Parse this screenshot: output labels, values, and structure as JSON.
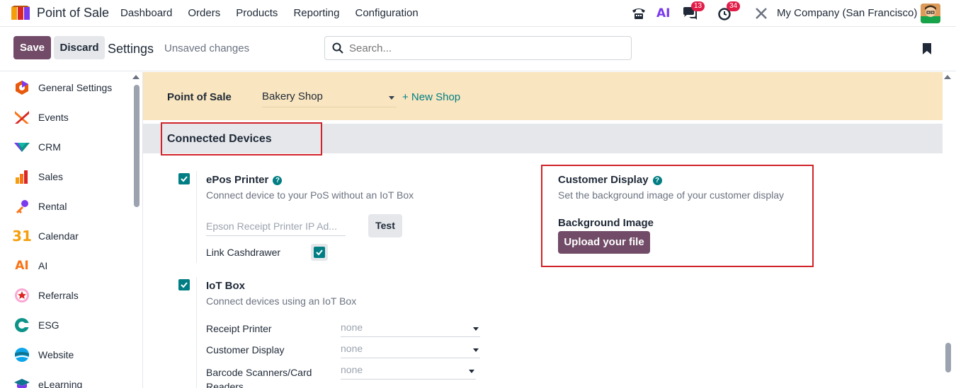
{
  "navbar": {
    "app_name": "Point of Sale",
    "menu": [
      "Dashboard",
      "Orders",
      "Products",
      "Reporting",
      "Configuration"
    ],
    "chat_count": "13",
    "activity_count": "34",
    "ai_label": "AI",
    "company": "My Company (San Francisco)"
  },
  "control_panel": {
    "save_label": "Save",
    "discard_label": "Discard",
    "title": "Settings",
    "status": "Unsaved changes",
    "search_placeholder": "Search..."
  },
  "sidebar": {
    "items": [
      {
        "label": "General Settings",
        "icon": "general-settings-icon",
        "color": "#e8590c"
      },
      {
        "label": "Events",
        "icon": "events-icon",
        "color": "#f97316"
      },
      {
        "label": "CRM",
        "icon": "crm-icon",
        "color": "#0d9488"
      },
      {
        "label": "Sales",
        "icon": "sales-icon",
        "color": "#f97316"
      },
      {
        "label": "Rental",
        "icon": "rental-icon",
        "color": "#7c3aed"
      },
      {
        "label": "Calendar",
        "icon": "calendar-icon",
        "color": "#f59e0b"
      },
      {
        "label": "AI",
        "icon": "ai-icon",
        "color": "#f97316"
      },
      {
        "label": "Referrals",
        "icon": "referrals-icon",
        "color": "#dc2626"
      },
      {
        "label": "ESG",
        "icon": "esg-icon",
        "color": "#0d9488"
      },
      {
        "label": "Website",
        "icon": "website-icon",
        "color": "#0ea5e9"
      },
      {
        "label": "eLearning",
        "icon": "elearning-icon",
        "color": "#0e7490"
      }
    ]
  },
  "shop_bar": {
    "label": "Point of Sale",
    "selected_shop": "Bakery Shop",
    "new_shop_label": "+ New Shop"
  },
  "section": {
    "title": "Connected Devices"
  },
  "epos": {
    "title": "ePos Printer",
    "description": "Connect device to your PoS without an IoT Box",
    "ip_placeholder": "Epson Receipt Printer IP Ad...",
    "test_label": "Test",
    "cashdrawer_label": "Link Cashdrawer",
    "checked": true,
    "cashdrawer_checked": true
  },
  "iot": {
    "title": "IoT Box",
    "description": "Connect devices using an IoT Box",
    "checked": true,
    "rows": [
      {
        "label": "Receipt Printer",
        "value": "none"
      },
      {
        "label": "Customer Display",
        "value": "none"
      },
      {
        "label": "Barcode Scanners/Card Readers",
        "value": "none"
      }
    ]
  },
  "customer_display": {
    "title": "Customer Display",
    "description": "Set the background image of your customer display",
    "bg_label": "Background Image",
    "upload_label": "Upload your file"
  },
  "colors": {
    "brand": "#714b67",
    "accent": "#017e84",
    "highlight": "#d1232a",
    "shop_bar": "#f9e5bf"
  }
}
